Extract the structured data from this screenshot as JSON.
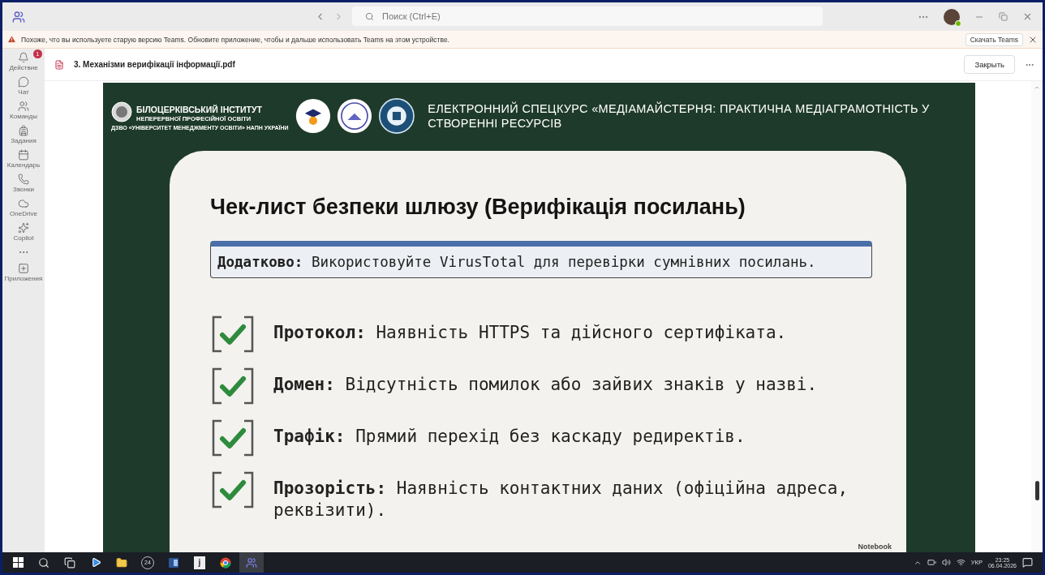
{
  "window": {
    "search_placeholder": "Поиск (Ctrl+E)"
  },
  "banner": {
    "message": "Похоже, что вы используете старую версию Teams. Обновите приложение, чтобы и дальше использовать Teams на этом устройстве.",
    "button": "Скачать Teams"
  },
  "rail": [
    {
      "kind": "bell",
      "label": "Действие",
      "badge": "1"
    },
    {
      "kind": "chat",
      "label": "Чат"
    },
    {
      "kind": "teams",
      "label": "Команды"
    },
    {
      "kind": "tasks",
      "label": "Задания"
    },
    {
      "kind": "calendar",
      "label": "Календарь"
    },
    {
      "kind": "calls",
      "label": "Звонки"
    },
    {
      "kind": "cloud",
      "label": "OneDrive"
    },
    {
      "kind": "copilot",
      "label": "Copilot"
    },
    {
      "kind": "more"
    },
    {
      "kind": "apps",
      "label": "Приложения"
    }
  ],
  "document": {
    "title": "3. Механізми верифікації інформації.pdf",
    "close_button": "Закрыть"
  },
  "slide": {
    "institute_name": "БІЛОЦЕРКІВСЬКИЙ ІНСТИТУТ",
    "institute_subtitle": "НЕПЕРЕРВНОЇ ПРОФЕСІЙНОЇ ОСВІТИ",
    "institute_parent": "ДЗВО «УНІВЕРСИТЕТ МЕНЕДЖМЕНТУ ОСВІТИ» НАПН УКРАЇНИ",
    "course_title": "ЕЛЕКТРОННИЙ СПЕЦКУРС «МЕДІАМАЙСТЕРНЯ: ПРАКТИЧНА МЕДІАГРАМОТНІСТЬ У СТВОРЕННІ РЕСУРСІВ",
    "heading": "Чек-лист безпеки шлюзу (Верифікація посилань)",
    "note": {
      "label": "Додатково:",
      "text": "Використовуйте VirusTotal для перевірки сумнівних посилань."
    },
    "checklist": [
      {
        "label": "Протокол:",
        "text": "Наявність HTTPS та дійсного сертифіката.",
        "checked": true
      },
      {
        "label": "Домен:",
        "text": "Відсутність помилок або зайвих знаків у назві.",
        "checked": true
      },
      {
        "label": "Трафік:",
        "text": "Прямий перехід без каскаду редиректів.",
        "checked": true
      },
      {
        "label": "Прозорість:",
        "text": "Наявність контактних даних (офіційна адреса, реквізити).",
        "checked": true
      }
    ],
    "footer_brand": "Notebook"
  },
  "taskbar": {
    "apps": [
      {
        "kind": "start",
        "selected": false
      },
      {
        "kind": "search",
        "selected": false
      },
      {
        "kind": "taskview",
        "selected": false
      },
      {
        "kind": "player",
        "selected": false
      },
      {
        "kind": "folder",
        "selected": false
      },
      {
        "kind": "counter",
        "label": "24",
        "selected": false
      },
      {
        "kind": "word",
        "selected": false
      },
      {
        "kind": "letter",
        "label": "j",
        "selected": false
      },
      {
        "kind": "browser",
        "selected": false
      },
      {
        "kind": "teams",
        "selected": true
      }
    ],
    "language": "УКР",
    "time": "23:25",
    "date": "06.04.2026"
  }
}
